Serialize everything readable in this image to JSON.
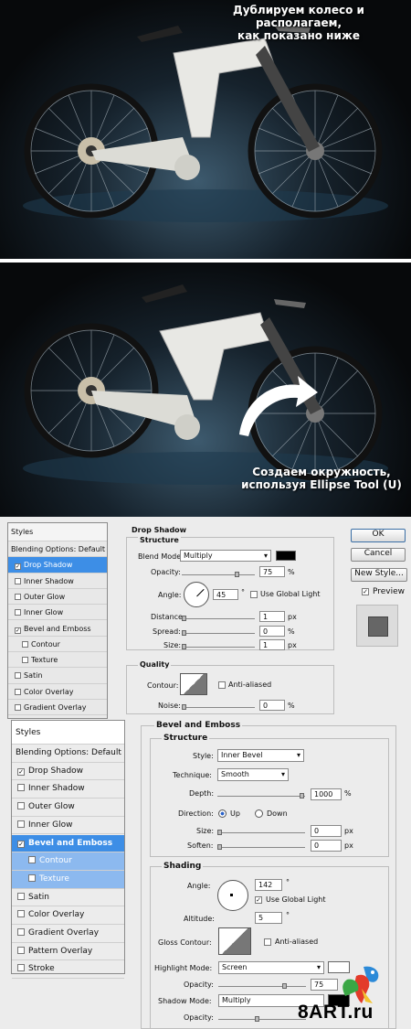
{
  "panel1": {
    "caption_line1": "Дублируем колесо и располагаем,",
    "caption_line2": "как показано ниже"
  },
  "panel2": {
    "caption_line1": "Создаем окружность,",
    "caption_line2": "используя Ellipse Tool (U)"
  },
  "dialog1": {
    "list_header": "Styles",
    "list_items": [
      "Blending Options: Default",
      "Drop Shadow",
      "Inner Shadow",
      "Outer Glow",
      "Inner Glow",
      "Bevel and Emboss",
      "Contour",
      "Texture",
      "Satin",
      "Color Overlay",
      "Gradient Overlay"
    ],
    "list_checked": [
      false,
      true,
      false,
      false,
      false,
      true,
      false,
      false,
      false,
      false,
      false
    ],
    "section_title": "Drop Shadow",
    "structure_title": "Structure",
    "blend_mode_label": "Blend Mode:",
    "blend_mode_value": "Multiply",
    "opacity_label": "Opacity:",
    "opacity_value": "75",
    "percent": "%",
    "angle_label": "Angle:",
    "angle_value": "45",
    "degree": "°",
    "use_global_light": "Use Global Light",
    "distance_label": "Distance:",
    "distance_value": "1",
    "spread_label": "Spread:",
    "spread_value": "0",
    "size_label": "Size:",
    "size_value": "1",
    "px": "px",
    "quality_title": "Quality",
    "contour_label": "Contour:",
    "anti_aliased": "Anti-aliased",
    "noise_label": "Noise:",
    "noise_value": "0",
    "ok": "OK",
    "cancel": "Cancel",
    "new_style": "New Style...",
    "preview": "Preview"
  },
  "dialog2": {
    "list_header": "Styles",
    "list_items": [
      "Blending Options: Default",
      "Drop Shadow",
      "Inner Shadow",
      "Outer Glow",
      "Inner Glow",
      "Bevel and Emboss",
      "Contour",
      "Texture",
      "Satin",
      "Color Overlay",
      "Gradient Overlay",
      "Pattern Overlay",
      "Stroke"
    ],
    "list_checked": [
      false,
      true,
      false,
      false,
      false,
      true,
      false,
      false,
      false,
      false,
      false,
      false,
      false
    ],
    "section_title": "Bevel and Emboss",
    "structure_title": "Structure",
    "style_label": "Style:",
    "style_value": "Inner Bevel",
    "technique_label": "Technique:",
    "technique_value": "Smooth",
    "depth_label": "Depth:",
    "depth_value": "1000",
    "percent": "%",
    "direction_label": "Direction:",
    "up": "Up",
    "down": "Down",
    "size_label": "Size:",
    "size_value": "0",
    "soften_label": "Soften:",
    "soften_value": "0",
    "px": "px",
    "shading_title": "Shading",
    "angle_label": "Angle:",
    "angle_value": "142",
    "degree": "°",
    "use_global_light": "Use Global Light",
    "altitude_label": "Altitude:",
    "altitude_value": "5",
    "gloss_contour_label": "Gloss Contour:",
    "anti_aliased": "Anti-aliased",
    "highlight_mode_label": "Highlight Mode:",
    "highlight_mode_value": "Screen",
    "opacity_label": "Opacity:",
    "opacity_value": "75",
    "shadow_mode_label": "Shadow Mode:",
    "shadow_mode_value": "Multiply",
    "opacity2_label": "Opacity:"
  },
  "watermark": "8ART.ru"
}
